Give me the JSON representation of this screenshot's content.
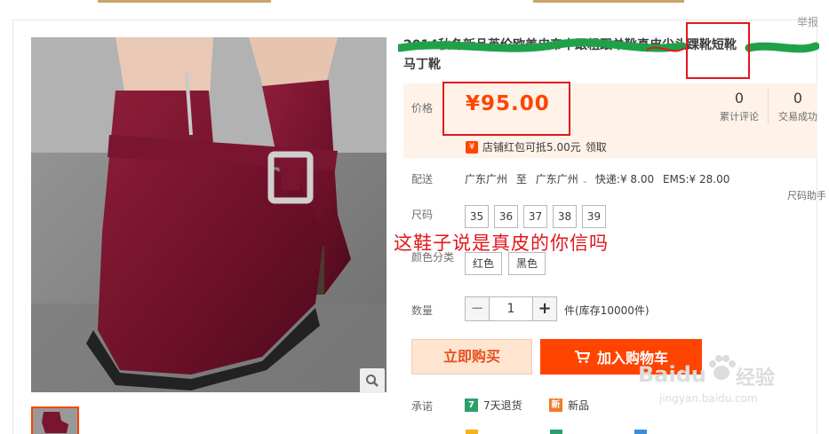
{
  "report_label": "举报",
  "title": {
    "line1_visible": "2014秋冬新品英伦欧美皮帝中跟粗跟单靴真皮尖头踝靴短靴",
    "line2": "马丁靴"
  },
  "price": {
    "label": "价格",
    "value": "¥95.00"
  },
  "stats": [
    {
      "count": "0",
      "label": "累计评论"
    },
    {
      "count": "0",
      "label": "交易成功"
    }
  ],
  "coupon": {
    "icon_text": "¥",
    "text": "店铺红包可抵5.00元",
    "action": "领取"
  },
  "shipping": {
    "label": "配送",
    "from": "广东广州",
    "to_word": "至",
    "to": "广东广州",
    "express": "快递:¥ 8.00",
    "ems": "EMS:¥ 28.00"
  },
  "size_helper": "尺码助手",
  "size": {
    "label": "尺码",
    "options": [
      "35",
      "36",
      "37",
      "38",
      "39"
    ]
  },
  "color": {
    "label": "颜色分类",
    "options": [
      "红色",
      "黑色"
    ]
  },
  "annotation": "这鞋子说是真皮的你信吗",
  "quantity": {
    "label": "数量",
    "value": "1",
    "minus": "−",
    "plus": "+",
    "stock": "件(库存10000件)"
  },
  "buttons": {
    "buy_now": "立即购买",
    "add_cart": "加入购物车"
  },
  "promise": {
    "label": "承诺",
    "items": [
      {
        "badge": "7",
        "text": "7天退货",
        "color": "#2ca06b"
      },
      {
        "badge": "新",
        "text": "新品",
        "color": "#f07a2b"
      }
    ]
  },
  "watermark": {
    "brand": "Baidu",
    "cn": "经验",
    "url": "jingyan.baidu.com"
  },
  "colors": {
    "accent": "#ff4400",
    "price": "#ff4400",
    "annotation_red": "#e4161c",
    "price_bg": "#fff2e8"
  }
}
